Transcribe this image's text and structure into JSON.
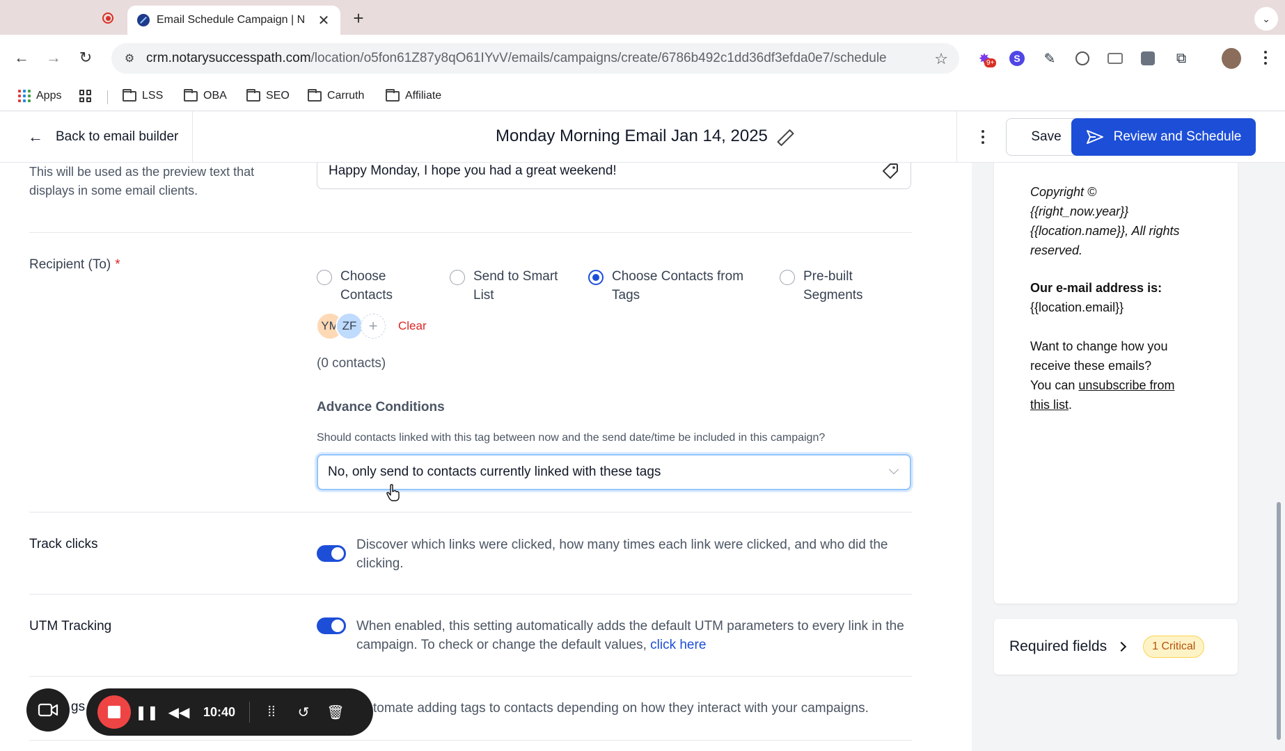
{
  "browser": {
    "tab_title": "Email Schedule Campaign | N",
    "url_host": "crm.notarysuccesspath.com",
    "url_path": "/location/o5fon61Z87y8qO61IYvV/emails/campaigns/create/6786b492c1dd36df3efda0e7/schedule",
    "extension_badge": "9+",
    "extension_s": "S",
    "bookmarks": [
      "Apps",
      "LSS",
      "OBA",
      "SEO",
      "Carruth",
      "Affiliate"
    ]
  },
  "header": {
    "back_label": "Back to email builder",
    "campaign_title": "Monday Morning Email Jan 14, 2025",
    "save_label": "Save",
    "review_label": "Review and Schedule"
  },
  "preview_text": {
    "help": "This will be used as the preview text that displays in some email clients.",
    "value": "Happy Monday, I hope you had a great weekend!"
  },
  "recipient": {
    "label": "Recipient (To)",
    "required_mark": "*",
    "options": [
      "Choose Contacts",
      "Send to Smart List",
      "Choose Contacts from Tags",
      "Pre-built Segments"
    ],
    "selected": "Choose Contacts from Tags",
    "chips": [
      "YM",
      "ZF"
    ],
    "add_symbol": "+",
    "clear_label": "Clear",
    "contacts_count": "(0 contacts)",
    "advance_title": "Advance Conditions",
    "advance_question": "Should contacts linked with this tag between now and the send date/time be included in this campaign?",
    "advance_selected": "No, only send to contacts currently linked with these tags"
  },
  "track_clicks": {
    "label": "Track clicks",
    "enabled": true,
    "desc": "Discover which links were clicked, how many times each link were clicked, and who did the clicking."
  },
  "utm": {
    "label": "UTM Tracking",
    "enabled": true,
    "desc": "When enabled, this setting automatically adds the default UTM parameters to every link in the campaign. To check or change the default values, ",
    "link": "click here"
  },
  "tags_row": {
    "label_partial": "gs",
    "desc_partial": "tomate adding tags to contacts depending on how they interact with your campaigns."
  },
  "recorder": {
    "time": "10:40"
  },
  "preview_footer": {
    "copyright_1": "Copyright ©",
    "copyright_2": "{{right_now.year}}",
    "copyright_3": "{{location.name}}, All rights",
    "copyright_4": "reserved.",
    "email_label": "Our e-mail address is:",
    "email_value": "{{location.email}}",
    "change_1": "Want to change how you",
    "change_2": "receive these emails?",
    "change_3": "You can ",
    "unsubscribe_1": "unsubscribe from",
    "unsubscribe_2": "this list",
    "period": "."
  },
  "required_fields": {
    "label": "Required fields",
    "badge": "1 Critical"
  }
}
